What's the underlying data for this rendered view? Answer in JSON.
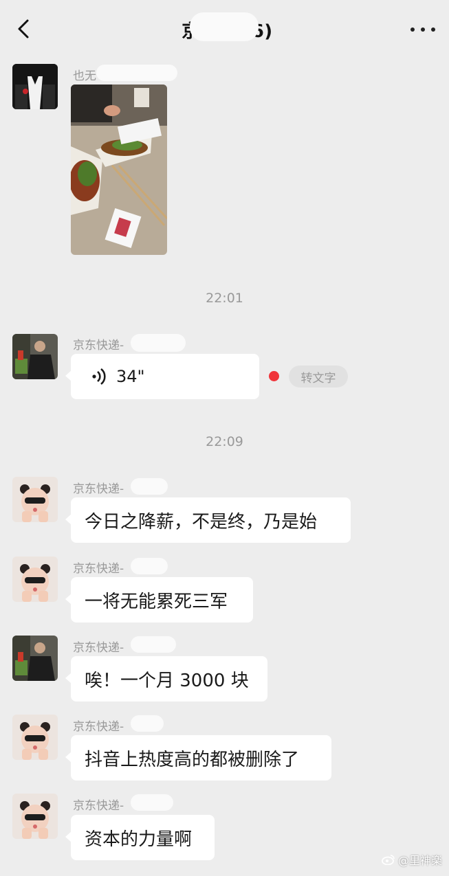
{
  "header": {
    "title": "京东 队(6)"
  },
  "messages": [
    {
      "type": "image",
      "sender": "也无"
    },
    {
      "type": "time",
      "text": "22:01"
    },
    {
      "type": "voice",
      "sender": "京东快递-",
      "duration": "34\"",
      "to_text": "转文字"
    },
    {
      "type": "time",
      "text": "22:09"
    },
    {
      "type": "text",
      "sender": "京东快递-",
      "text": "今日之降薪，不是终，乃是始"
    },
    {
      "type": "text",
      "sender": "京东快递-",
      "text": "一将无能累死三军"
    },
    {
      "type": "text",
      "sender": "京东快递-",
      "text": "唉！一个月 3000 块"
    },
    {
      "type": "text",
      "sender": "京东快递-",
      "text": "抖音上热度高的都被删除了"
    },
    {
      "type": "text",
      "sender": "京东快递-",
      "text": "资本的力量啊"
    }
  ],
  "watermark": "@里神楽",
  "colors": {
    "background": "#ededed",
    "bubble": "#ffffff",
    "unread": "#f0343a"
  }
}
